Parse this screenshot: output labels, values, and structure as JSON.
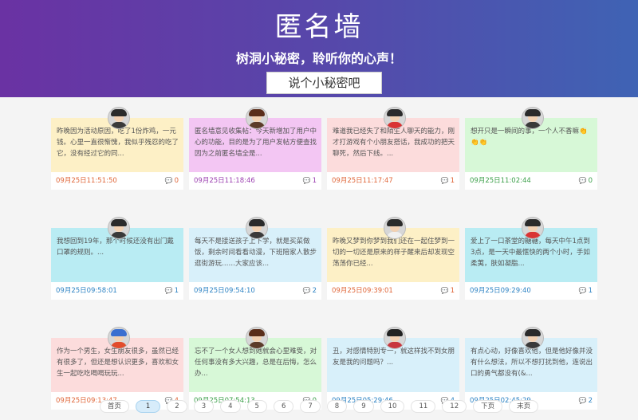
{
  "hero": {
    "title": "匿名墙",
    "subtitle": "树洞小秘密，聆听你的心声！",
    "button": "说个小秘密吧"
  },
  "cards": [
    {
      "text": "昨晚因为活动原因，吃了1份炸鸡，一元钱。心里一直很惭愧，我似乎残忍的吃了它，没有经过它的同...",
      "time": "09月25日11:51:50",
      "comments": "0",
      "bg": "#fdf0c6",
      "accent": "#e0673a",
      "avatar": "male"
    },
    {
      "text": "匿名墙意见收集帖：今天新增加了用户中心的功能，目的是为了用户发帖方便查找因为之前匿名墙全是...",
      "time": "09月25日11:18:46",
      "comments": "1",
      "bg": "#f3c6f3",
      "accent": "#9b3fb0",
      "avatar": "female"
    },
    {
      "text": "难道我已经失了和陌生人聊天的能力，刚才打游戏有个小朋友搭话，我成功的把天聊死，然后下线。...",
      "time": "09月25日11:17:47",
      "comments": "1",
      "bg": "#fcdcdc",
      "accent": "#e0673a",
      "avatar": "red"
    },
    {
      "text": "想开只是一瞬间的事，一个人不香嘛👏👏👏",
      "time": "09月25日11:02:44",
      "comments": "0",
      "bg": "#d7f8d7",
      "accent": "#3ca04a",
      "avatar": "male"
    },
    {
      "text": "我想回到19年，那个时候还没有出门戴口罩的规则。...",
      "time": "09月25日09:58:01",
      "comments": "1",
      "bg": "#b9ecf3",
      "accent": "#2f84c4",
      "avatar": "male"
    },
    {
      "text": "每天不是接送孩子上下学，就是买菜做饭，剩余时间看看动漫，下班陪家人散步逛街游玩……大家应该...",
      "time": "09月25日09:54:10",
      "comments": "2",
      "bg": "#d8f0fa",
      "accent": "#2f84c4",
      "avatar": "male"
    },
    {
      "text": "昨晚又梦到你梦到我们还在一起住梦到一切的一切还是原来的样子醒来后却发现空荡荡你已经...",
      "time": "09月25日09:39:01",
      "comments": "1",
      "bg": "#fdf0c6",
      "accent": "#e0673a",
      "avatar": "kid"
    },
    {
      "text": "爱上了一口茶堂的糖糖，每天中午1点到3点，是一天中最惬快的两个小时，手如柔荑，肤如凝脂...",
      "time": "09月25日09:29:40",
      "comments": "1",
      "bg": "#b9ecf3",
      "accent": "#2f84c4",
      "avatar": "red"
    },
    {
      "text": "作为一个男生，女生朋友很多，虽然已经有很多了，但还是想认识更多，喜欢和女生一起吃吃喝喝玩玩...",
      "time": "09月25日09:13:47",
      "comments": "4",
      "bg": "#fcdcdc",
      "accent": "#e0673a",
      "avatar": "blue"
    },
    {
      "text": "忘不了一个女人想到她就会心里难受，对任何事没有多大兴趣，总是在后悔，怎么办...",
      "time": "09月25日07:54:13",
      "comments": "0",
      "bg": "#d7f8d7",
      "accent": "#3ca04a",
      "avatar": "female"
    },
    {
      "text": "丑，对感情特别专一，就这样找不到女朋友是我的问题吗？...",
      "time": "09月25日05:29:46",
      "comments": "4",
      "bg": "#d8f0fa",
      "accent": "#2f84c4",
      "avatar": "girl"
    },
    {
      "text": "有点心动，好像喜欢他，但是他好像并没有什么想法，所以不想打扰到他，连说出口的勇气都没有(&...",
      "time": "09月25日02:45:29",
      "comments": "2",
      "bg": "#d8f0fa",
      "accent": "#2f84c4",
      "avatar": "male"
    }
  ],
  "pagination": {
    "first": "首页",
    "pages": [
      "1",
      "2",
      "3",
      "4",
      "5",
      "6",
      "7",
      "8",
      "9",
      "10",
      "11",
      "12"
    ],
    "current": "1",
    "next": "下页",
    "last": "末页"
  }
}
